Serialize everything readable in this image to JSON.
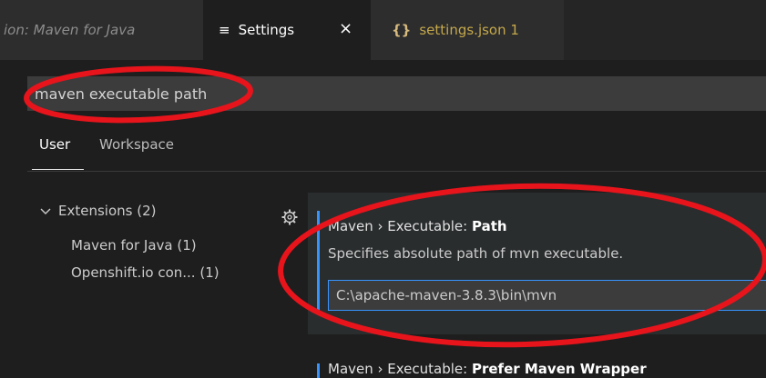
{
  "tabs": [
    {
      "label": "ion: Maven for Java"
    },
    {
      "label": "Settings",
      "icon": "settings-list-icon"
    },
    {
      "label": "settings.json 1",
      "icon": "json-braces-icon"
    }
  ],
  "tab_close_glyph": "×",
  "search": {
    "value": "maven executable path"
  },
  "scope_tabs": {
    "user": "User",
    "workspace": "Workspace"
  },
  "toc": {
    "extensions": "Extensions (2)",
    "maven": "Maven for Java (1)",
    "openshift": "Openshift.io con... (1)"
  },
  "setting_path": {
    "category": "Maven › Executable:",
    "name": "Path",
    "description": "Specifies absolute path of mvn executable.",
    "value": "C:\\apache-maven-3.8.3\\bin\\mvn"
  },
  "setting_wrapper": {
    "category": "Maven › Executable:",
    "name": "Prefer Maven Wrapper"
  },
  "colors": {
    "accent": "#3794ff",
    "annotation": "#e8141c",
    "json": "#c5a84b"
  }
}
